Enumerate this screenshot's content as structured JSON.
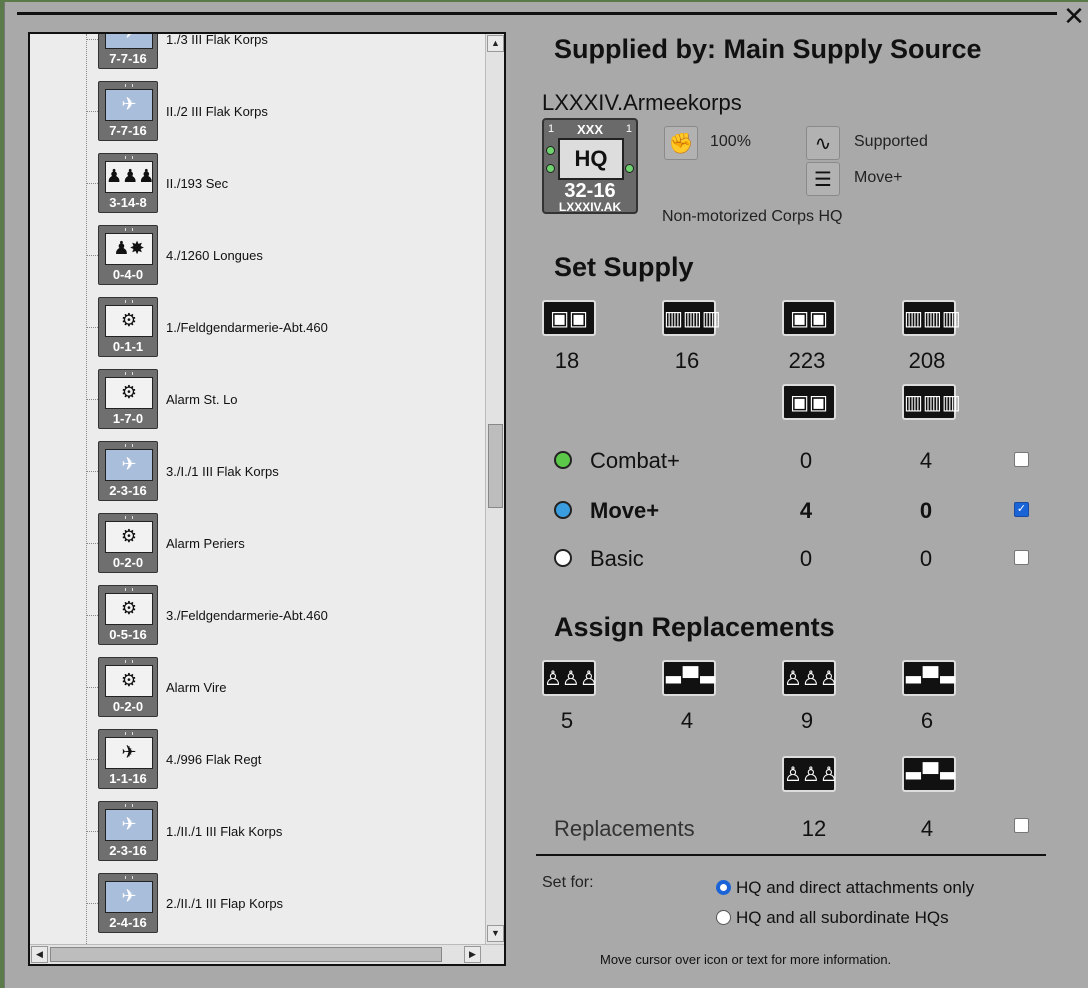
{
  "window": {
    "close_glyph": "✕"
  },
  "unit_list": [
    {
      "name": "1./3 III Flak Korps",
      "value": "7-7-16",
      "type": "flak",
      "glyph": "✈"
    },
    {
      "name": "II./2 III Flak Korps",
      "value": "7-7-16",
      "type": "flak",
      "glyph": "✈"
    },
    {
      "name": "II./193 Sec",
      "value": "3-14-8",
      "type": "land",
      "glyph": "♟♟♟"
    },
    {
      "name": "4./1260 Longues",
      "value": "0-4-0",
      "type": "land",
      "glyph": "♟✸"
    },
    {
      "name": "1./Feldgendarmerie-Abt.460",
      "value": "0-1-1",
      "type": "land",
      "glyph": "⚙"
    },
    {
      "name": "Alarm St. Lo",
      "value": "1-7-0",
      "type": "land",
      "glyph": "⚙"
    },
    {
      "name": "3./I./1 III Flak Korps",
      "value": "2-3-16",
      "type": "flak",
      "glyph": "✈"
    },
    {
      "name": "Alarm Periers",
      "value": "0-2-0",
      "type": "land",
      "glyph": "⚙"
    },
    {
      "name": "3./Feldgendarmerie-Abt.460",
      "value": "0-5-16",
      "type": "land",
      "glyph": "⚙"
    },
    {
      "name": "Alarm Vire",
      "value": "0-2-0",
      "type": "land",
      "glyph": "⚙"
    },
    {
      "name": "4./996 Flak Regt",
      "value": "1-1-16",
      "type": "land",
      "glyph": "✈"
    },
    {
      "name": "1./II./1 III Flak Korps",
      "value": "2-3-16",
      "type": "flak",
      "glyph": "✈"
    },
    {
      "name": "2./II./1 III Flap Korps",
      "value": "2-4-16",
      "type": "flak",
      "glyph": "✈"
    }
  ],
  "scroll": {
    "up": "▲",
    "down": "▼",
    "left": "◀",
    "right": "▶"
  },
  "supplied_title": "Supplied by: Main Supply Source",
  "hq": {
    "name": "LXXXIV.Armeekorps",
    "size": "XXX",
    "corner_left": "1",
    "corner_right": "1",
    "symbol": "HQ",
    "strength": "32-16",
    "abbr": "LXXXIV.AK",
    "type_text": "Non-motorized Corps HQ",
    "readiness_icon": "fist-icon",
    "readiness_glyph": "✊",
    "readiness_text": "100%",
    "supported_icon": "wave-icon",
    "supported_glyph": "∿",
    "supported_text": "Supported",
    "move_icon": "fuel-icon",
    "move_glyph": "☰",
    "move_text": "Move+"
  },
  "set_supply": {
    "title": "Set Supply",
    "icon_ammo": "▣▣",
    "icon_fuel": "▥▥▥",
    "col_values": [
      "18",
      "16",
      "223",
      "208"
    ],
    "rows": [
      {
        "label": "Combat+",
        "a": "0",
        "b": "4",
        "color": "#5cc84a",
        "checked": false
      },
      {
        "label": "Move+",
        "a": "4",
        "b": "0",
        "color": "#3a9de0",
        "checked": true
      },
      {
        "label": "Basic",
        "a": "0",
        "b": "0",
        "color": "#ffffff",
        "checked": false
      }
    ],
    "check_glyph": "✓"
  },
  "replacements": {
    "title": "Assign Replacements",
    "icon_inf": "♙♙♙",
    "icon_tank": "▬▀▬",
    "col_values": [
      "5",
      "4",
      "9",
      "6"
    ],
    "row_label": "Replacements",
    "row_values": [
      "12",
      "4"
    ],
    "checked": false
  },
  "set_for": {
    "label": "Set for:",
    "options": [
      {
        "text": "HQ and direct attachments only",
        "selected": true
      },
      {
        "text": "HQ and all subordinate HQs",
        "selected": false
      }
    ]
  },
  "hint": "Move cursor over icon or text for more information."
}
